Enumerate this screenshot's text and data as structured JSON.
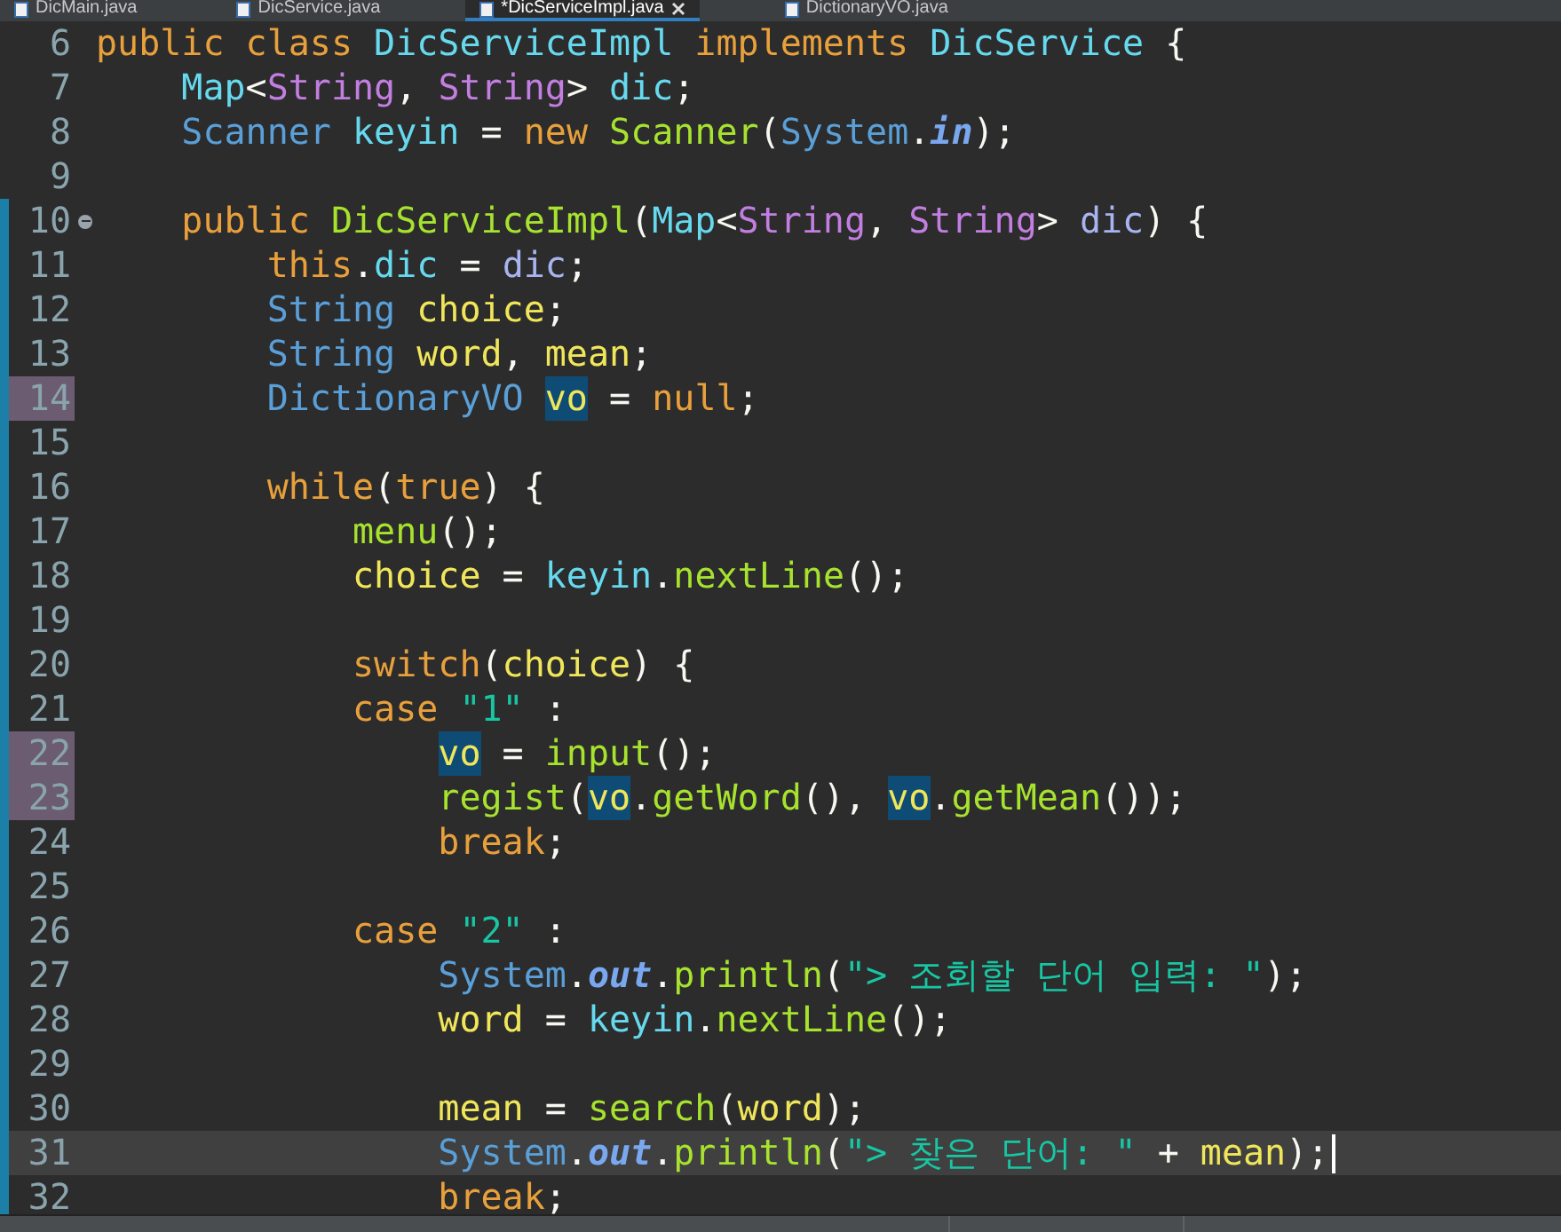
{
  "tabs": [
    {
      "label": "DicMain.java",
      "selected": false
    },
    {
      "label": "DicService.java",
      "selected": false
    },
    {
      "label": "*DicServiceImpl.java",
      "selected": true
    },
    {
      "label": "DictionaryVO.java",
      "selected": false
    }
  ],
  "lines": [
    {
      "number": "6",
      "changed": false,
      "marked": false,
      "folding": false,
      "current": false,
      "tokens": [
        {
          "text": "public class ",
          "kind": "kw"
        },
        {
          "text": "DicServiceImpl ",
          "kind": "type"
        },
        {
          "text": "implements ",
          "kind": "kw"
        },
        {
          "text": "DicService ",
          "kind": "type"
        },
        {
          "text": "{",
          "kind": "plain"
        }
      ]
    },
    {
      "number": "7",
      "changed": false,
      "marked": false,
      "folding": false,
      "current": false,
      "tokens": [
        {
          "text": "    Map",
          "kind": "type"
        },
        {
          "text": "<",
          "kind": "plain"
        },
        {
          "text": "String",
          "kind": "generic"
        },
        {
          "text": ", ",
          "kind": "plain"
        },
        {
          "text": "String",
          "kind": "generic"
        },
        {
          "text": "> ",
          "kind": "plain"
        },
        {
          "text": "dic",
          "kind": "field"
        },
        {
          "text": ";",
          "kind": "plain"
        }
      ]
    },
    {
      "number": "8",
      "changed": false,
      "marked": false,
      "folding": false,
      "current": false,
      "tokens": [
        {
          "text": "    Scanner ",
          "kind": "builtin"
        },
        {
          "text": "keyin",
          "kind": "field"
        },
        {
          "text": " = ",
          "kind": "plain"
        },
        {
          "text": "new ",
          "kind": "kw"
        },
        {
          "text": "Scanner",
          "kind": "method"
        },
        {
          "text": "(",
          "kind": "plain"
        },
        {
          "text": "System",
          "kind": "builtin"
        },
        {
          "text": ".",
          "kind": "plain"
        },
        {
          "text": "in",
          "kind": "static"
        },
        {
          "text": ");",
          "kind": "plain"
        }
      ]
    },
    {
      "number": "9",
      "changed": false,
      "marked": false,
      "folding": false,
      "current": false
    },
    {
      "number": "10",
      "changed": true,
      "marked": false,
      "folding": true,
      "current": false,
      "tokens": [
        {
          "text": "    public ",
          "kind": "kw"
        },
        {
          "text": "DicServiceImpl",
          "kind": "method"
        },
        {
          "text": "(",
          "kind": "plain"
        },
        {
          "text": "Map",
          "kind": "type"
        },
        {
          "text": "<",
          "kind": "plain"
        },
        {
          "text": "String",
          "kind": "generic"
        },
        {
          "text": ", ",
          "kind": "plain"
        },
        {
          "text": "String",
          "kind": "generic"
        },
        {
          "text": "> ",
          "kind": "plain"
        },
        {
          "text": "dic",
          "kind": "param"
        },
        {
          "text": ") {",
          "kind": "plain"
        }
      ]
    },
    {
      "number": "11",
      "changed": true,
      "marked": false,
      "folding": false,
      "current": false,
      "tokens": [
        {
          "text": "        this",
          "kind": "kw"
        },
        {
          "text": ".",
          "kind": "plain"
        },
        {
          "text": "dic",
          "kind": "field"
        },
        {
          "text": " = ",
          "kind": "plain"
        },
        {
          "text": "dic",
          "kind": "param"
        },
        {
          "text": ";",
          "kind": "plain"
        }
      ]
    },
    {
      "number": "12",
      "changed": true,
      "marked": false,
      "folding": false,
      "current": false,
      "tokens": [
        {
          "text": "        String ",
          "kind": "builtin"
        },
        {
          "text": "choice",
          "kind": "local"
        },
        {
          "text": ";",
          "kind": "plain"
        }
      ]
    },
    {
      "number": "13",
      "changed": true,
      "marked": false,
      "folding": false,
      "current": false,
      "tokens": [
        {
          "text": "        String ",
          "kind": "builtin"
        },
        {
          "text": "word",
          "kind": "local"
        },
        {
          "text": ", ",
          "kind": "plain"
        },
        {
          "text": "mean",
          "kind": "local"
        },
        {
          "text": ";",
          "kind": "plain"
        }
      ]
    },
    {
      "number": "14",
      "changed": true,
      "marked": true,
      "folding": false,
      "current": false,
      "tokens": [
        {
          "text": "        DictionaryVO ",
          "kind": "builtin"
        },
        {
          "text": "vo",
          "kind": "occurrence"
        },
        {
          "text": " = ",
          "kind": "plain"
        },
        {
          "text": "null",
          "kind": "kw"
        },
        {
          "text": ";",
          "kind": "plain"
        }
      ]
    },
    {
      "number": "15",
      "changed": true,
      "marked": false,
      "folding": false,
      "current": false
    },
    {
      "number": "16",
      "changed": true,
      "marked": false,
      "folding": false,
      "current": false,
      "tokens": [
        {
          "text": "        while",
          "kind": "kw"
        },
        {
          "text": "(",
          "kind": "plain"
        },
        {
          "text": "true",
          "kind": "kw"
        },
        {
          "text": ") {",
          "kind": "plain"
        }
      ]
    },
    {
      "number": "17",
      "changed": true,
      "marked": false,
      "folding": false,
      "current": false,
      "tokens": [
        {
          "text": "            menu",
          "kind": "method"
        },
        {
          "text": "();",
          "kind": "plain"
        }
      ]
    },
    {
      "number": "18",
      "changed": true,
      "marked": false,
      "folding": false,
      "current": false,
      "tokens": [
        {
          "text": "            choice",
          "kind": "local"
        },
        {
          "text": " = ",
          "kind": "plain"
        },
        {
          "text": "keyin",
          "kind": "field"
        },
        {
          "text": ".",
          "kind": "plain"
        },
        {
          "text": "nextLine",
          "kind": "method"
        },
        {
          "text": "();",
          "kind": "plain"
        }
      ]
    },
    {
      "number": "19",
      "changed": true,
      "marked": false,
      "folding": false,
      "current": false
    },
    {
      "number": "20",
      "changed": true,
      "marked": false,
      "folding": false,
      "current": false,
      "tokens": [
        {
          "text": "            switch",
          "kind": "kw"
        },
        {
          "text": "(",
          "kind": "plain"
        },
        {
          "text": "choice",
          "kind": "local"
        },
        {
          "text": ") {",
          "kind": "plain"
        }
      ]
    },
    {
      "number": "21",
      "changed": true,
      "marked": false,
      "folding": false,
      "current": false,
      "tokens": [
        {
          "text": "            case ",
          "kind": "kw"
        },
        {
          "text": "\"1\"",
          "kind": "string"
        },
        {
          "text": " :",
          "kind": "plain"
        }
      ]
    },
    {
      "number": "22",
      "changed": true,
      "marked": true,
      "folding": false,
      "current": false,
      "tokens": [
        {
          "text": "                vo",
          "kind": "occurrence"
        },
        {
          "text": " = ",
          "kind": "plain"
        },
        {
          "text": "input",
          "kind": "method"
        },
        {
          "text": "();",
          "kind": "plain"
        }
      ]
    },
    {
      "number": "23",
      "changed": true,
      "marked": true,
      "folding": false,
      "current": false,
      "tokens": [
        {
          "text": "                regist",
          "kind": "method"
        },
        {
          "text": "(",
          "kind": "plain"
        },
        {
          "text": "vo",
          "kind": "occurrence"
        },
        {
          "text": ".",
          "kind": "plain"
        },
        {
          "text": "getWord",
          "kind": "method"
        },
        {
          "text": "(), ",
          "kind": "plain"
        },
        {
          "text": "vo",
          "kind": "occurrence"
        },
        {
          "text": ".",
          "kind": "plain"
        },
        {
          "text": "getMean",
          "kind": "method"
        },
        {
          "text": "());",
          "kind": "plain"
        }
      ]
    },
    {
      "number": "24",
      "changed": true,
      "marked": false,
      "folding": false,
      "current": false,
      "tokens": [
        {
          "text": "                break",
          "kind": "kw"
        },
        {
          "text": ";",
          "kind": "plain"
        }
      ]
    },
    {
      "number": "25",
      "changed": true,
      "marked": false,
      "folding": false,
      "current": false
    },
    {
      "number": "26",
      "changed": true,
      "marked": false,
      "folding": false,
      "current": false,
      "tokens": [
        {
          "text": "            case ",
          "kind": "kw"
        },
        {
          "text": "\"2\"",
          "kind": "string"
        },
        {
          "text": " :",
          "kind": "plain"
        }
      ]
    },
    {
      "number": "27",
      "changed": true,
      "marked": false,
      "folding": false,
      "current": false,
      "tokens": [
        {
          "text": "                System",
          "kind": "builtin"
        },
        {
          "text": ".",
          "kind": "plain"
        },
        {
          "text": "out",
          "kind": "static"
        },
        {
          "text": ".",
          "kind": "plain"
        },
        {
          "text": "println",
          "kind": "method"
        },
        {
          "text": "(",
          "kind": "plain"
        },
        {
          "text": "\"> 조회할 단어 입력: \"",
          "kind": "string"
        },
        {
          "text": ");",
          "kind": "plain"
        }
      ]
    },
    {
      "number": "28",
      "changed": true,
      "marked": false,
      "folding": false,
      "current": false,
      "tokens": [
        {
          "text": "                word",
          "kind": "local"
        },
        {
          "text": " = ",
          "kind": "plain"
        },
        {
          "text": "keyin",
          "kind": "field"
        },
        {
          "text": ".",
          "kind": "plain"
        },
        {
          "text": "nextLine",
          "kind": "method"
        },
        {
          "text": "();",
          "kind": "plain"
        }
      ]
    },
    {
      "number": "29",
      "changed": true,
      "marked": false,
      "folding": false,
      "current": false
    },
    {
      "number": "30",
      "changed": true,
      "marked": false,
      "folding": false,
      "current": false,
      "tokens": [
        {
          "text": "                mean",
          "kind": "local"
        },
        {
          "text": " = ",
          "kind": "plain"
        },
        {
          "text": "search",
          "kind": "method"
        },
        {
          "text": "(",
          "kind": "plain"
        },
        {
          "text": "word",
          "kind": "local"
        },
        {
          "text": ");",
          "kind": "plain"
        }
      ]
    },
    {
      "number": "31",
      "changed": true,
      "marked": false,
      "folding": false,
      "current": true,
      "tokens": [
        {
          "text": "                System",
          "kind": "builtin"
        },
        {
          "text": ".",
          "kind": "plain"
        },
        {
          "text": "out",
          "kind": "static"
        },
        {
          "text": ".",
          "kind": "plain"
        },
        {
          "text": "println",
          "kind": "method"
        },
        {
          "text": "(",
          "kind": "plain"
        },
        {
          "text": "\"> 찾은 단어: \"",
          "kind": "string"
        },
        {
          "text": " + ",
          "kind": "plain"
        },
        {
          "text": "mean",
          "kind": "local"
        },
        {
          "text": ");",
          "kind": "plain"
        }
      ]
    },
    {
      "number": "32",
      "changed": true,
      "marked": false,
      "folding": false,
      "current": false,
      "tokens": [
        {
          "text": "                break",
          "kind": "kw"
        },
        {
          "text": ";",
          "kind": "plain"
        }
      ]
    }
  ]
}
